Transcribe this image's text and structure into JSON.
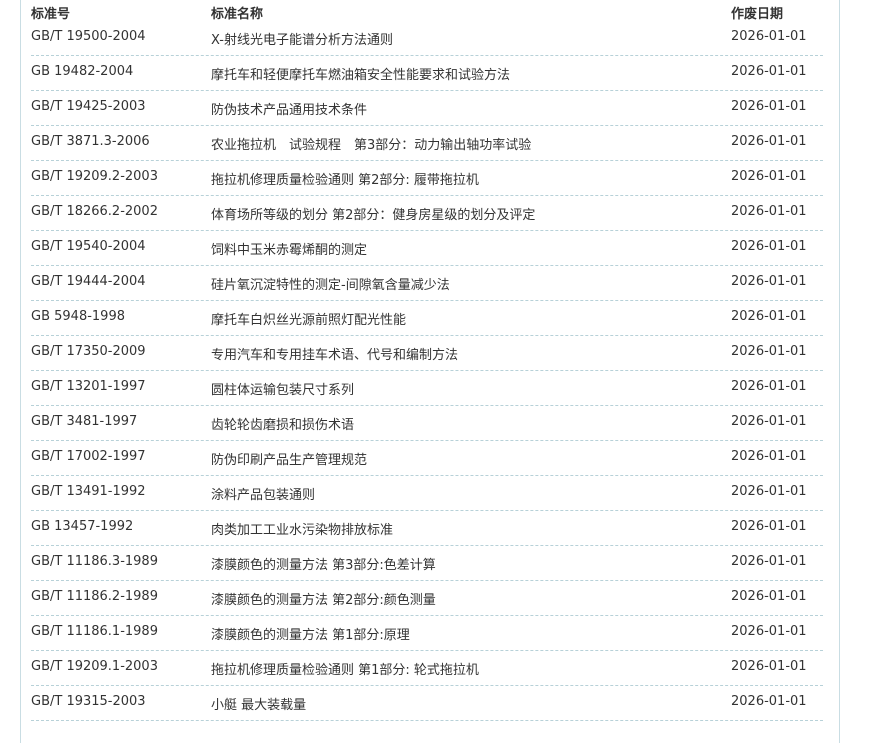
{
  "table": {
    "headers": {
      "code": "标准号",
      "name": "标准名称",
      "date": "作废日期"
    },
    "rows": [
      {
        "code": "GB/T 19500-2004",
        "name": "X-射线光电子能谱分析方法通则",
        "date": "2026-01-01"
      },
      {
        "code": "GB 19482-2004",
        "name": "摩托车和轻便摩托车燃油箱安全性能要求和试验方法",
        "date": "2026-01-01"
      },
      {
        "code": "GB/T 19425-2003",
        "name": "防伪技术产品通用技术条件",
        "date": "2026-01-01"
      },
      {
        "code": "GB/T 3871.3-2006",
        "name": "农业拖拉机　试验规程　第3部分：动力输出轴功率试验",
        "date": "2026-01-01"
      },
      {
        "code": "GB/T 19209.2-2003",
        "name": "拖拉机修理质量检验通则 第2部分: 履带拖拉机",
        "date": "2026-01-01"
      },
      {
        "code": "GB/T 18266.2-2002",
        "name": "体育场所等级的划分 第2部分：健身房星级的划分及评定",
        "date": "2026-01-01"
      },
      {
        "code": "GB/T 19540-2004",
        "name": "饲料中玉米赤霉烯酮的测定",
        "date": "2026-01-01"
      },
      {
        "code": "GB/T 19444-2004",
        "name": "硅片氧沉淀特性的测定-间隙氧含量减少法",
        "date": "2026-01-01"
      },
      {
        "code": "GB 5948-1998",
        "name": "摩托车白炽丝光源前照灯配光性能",
        "date": "2026-01-01"
      },
      {
        "code": "GB/T 17350-2009",
        "name": "专用汽车和专用挂车术语、代号和编制方法",
        "date": "2026-01-01"
      },
      {
        "code": "GB/T 13201-1997",
        "name": "圆柱体运输包装尺寸系列",
        "date": "2026-01-01"
      },
      {
        "code": "GB/T 3481-1997",
        "name": "齿轮轮齿磨损和损伤术语",
        "date": "2026-01-01"
      },
      {
        "code": "GB/T 17002-1997",
        "name": "防伪印刷产品生产管理规范",
        "date": "2026-01-01"
      },
      {
        "code": "GB/T 13491-1992",
        "name": "涂料产品包装通则",
        "date": "2026-01-01"
      },
      {
        "code": "GB 13457-1992",
        "name": "肉类加工工业水污染物排放标准",
        "date": "2026-01-01"
      },
      {
        "code": "GB/T 11186.3-1989",
        "name": "漆膜颜色的测量方法 第3部分:色差计算",
        "date": "2026-01-01"
      },
      {
        "code": "GB/T 11186.2-1989",
        "name": "漆膜颜色的测量方法 第2部分:颜色测量",
        "date": "2026-01-01"
      },
      {
        "code": "GB/T 11186.1-1989",
        "name": "漆膜颜色的测量方法 第1部分:原理",
        "date": "2026-01-01"
      },
      {
        "code": "GB/T 19209.1-2003",
        "name": "拖拉机修理质量检验通则 第1部分: 轮式拖拉机",
        "date": "2026-01-01"
      },
      {
        "code": "GB/T 19315-2003",
        "name": "小艇 最大装载量",
        "date": "2026-01-01"
      }
    ]
  }
}
